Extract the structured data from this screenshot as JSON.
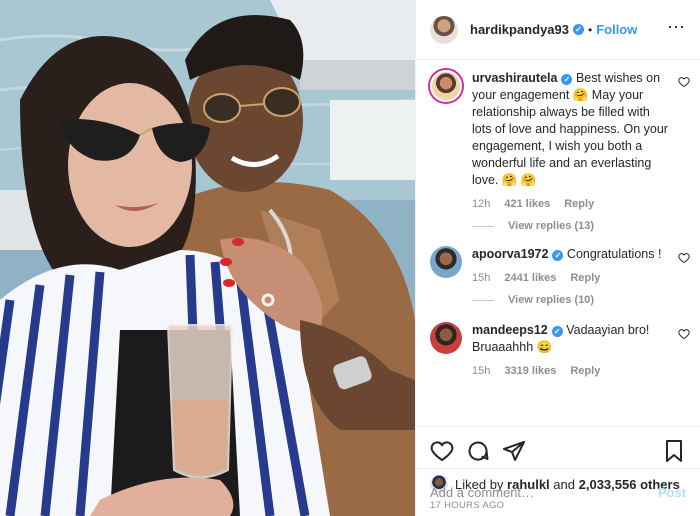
{
  "post": {
    "username": "hardikpandya93",
    "verified_mark": "✓",
    "separator": "•",
    "follow_label": "Follow",
    "more_label": "⋯"
  },
  "comments": [
    {
      "username": "urvashirautela",
      "verified_mark": "✓",
      "text": "Best wishes on your engagement 🤗 May your relationship always be filled with lots of love and happiness. On your engagement, I wish you both a wonderful life and an everlasting love. 🤗 🤗",
      "time": "12h",
      "likes": "421 likes",
      "reply_label": "Reply",
      "view_replies": "View replies (13)"
    },
    {
      "username": "apoorva1972",
      "verified_mark": "✓",
      "text": "Congratulations !",
      "time": "15h",
      "likes": "2441 likes",
      "reply_label": "Reply",
      "view_replies": "View replies (10)"
    },
    {
      "username": "mandeeps12",
      "verified_mark": "✓",
      "text": "Vadaayian bro! Bruaaahhh 😄",
      "time": "15h",
      "likes": "3319 likes",
      "reply_label": "Reply"
    }
  ],
  "liked_by": {
    "prefix": "Liked by",
    "user": "rahulkl",
    "and": "and",
    "others": "2,033,556 others"
  },
  "time_ago": "17 HOURS AGO",
  "add_comment": {
    "placeholder": "Add a comment…",
    "post_label": "Post"
  },
  "icons": {
    "heart": "heart-icon",
    "comment": "comment-icon",
    "share": "share-icon",
    "save": "bookmark-icon"
  }
}
